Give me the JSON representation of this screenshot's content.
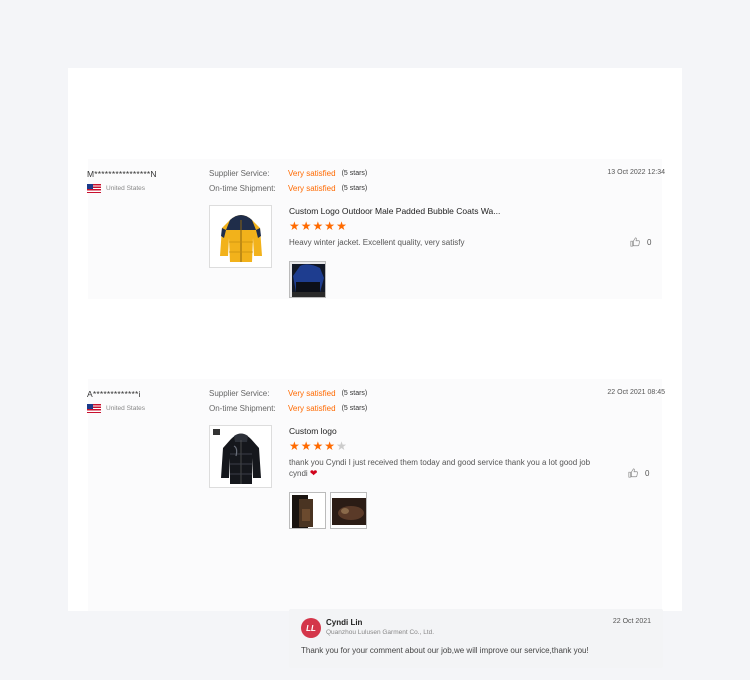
{
  "reviews": [
    {
      "buyer": "M****************N",
      "country": "United States",
      "date": "13 Oct 2022 12:34",
      "supplier_service_label": "Supplier Service:",
      "supplier_service_value": "Very satisfied",
      "supplier_service_stars": "(5 stars)",
      "shipment_label": "On-time Shipment:",
      "shipment_value": "Very satisfied",
      "shipment_stars": "(5 stars)",
      "product_title": "Custom Logo Outdoor Male Padded Bubble Coats Wa...",
      "rating": 5,
      "comment": "Heavy winter jacket. Excellent quality, very satisfy",
      "likes": "0",
      "photo_count": 1
    },
    {
      "buyer": "A*************i",
      "country": "United States",
      "date": "22 Oct 2021 08:45",
      "supplier_service_label": "Supplier Service:",
      "supplier_service_value": "Very satisfied",
      "supplier_service_stars": "(5 stars)",
      "shipment_label": "On-time Shipment:",
      "shipment_value": "Very satisfied",
      "shipment_stars": "(5 stars)",
      "product_title": "Custom logo",
      "rating": 4,
      "comment": "thank you  Cyndi I just received them today and good service thank you a lot good job cyndi",
      "likes": "0",
      "photo_count": 2,
      "reply": {
        "name": "Cyndi Lin",
        "company": "Quanzhou Lulusen Garment Co., Ltd.",
        "date": "22 Oct 2021",
        "text": "Thank you for your comment about our job,we will improve our service,thank you!"
      }
    }
  ],
  "colors": {
    "accent": "#ff6a00",
    "page_bg": "#f4f5f8",
    "heart": "#d0021b"
  },
  "icons": {
    "like": "thumbs-up-icon",
    "heart": "heart-icon",
    "flag": "us-flag-icon",
    "star": "star-icon"
  }
}
